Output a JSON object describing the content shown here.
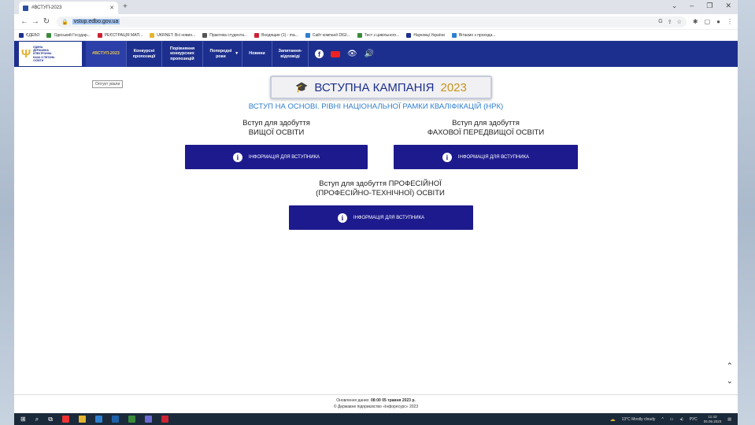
{
  "browser": {
    "tab_title": "#ВСТУП-2023",
    "new_tab": "+",
    "url": "vstup.edbo.gov.ua",
    "bookmarks": [
      {
        "label": "ЄДЕБО",
        "color": "#1d2f8e"
      },
      {
        "label": "Одеський Государ...",
        "color": "#3a8a3a"
      },
      {
        "label": "РЕЄСТРАЦІЯ МАП...",
        "color": "#c23"
      },
      {
        "label": "UKRNET: Всі новин...",
        "color": "#e3b430"
      },
      {
        "label": "Практика студента...",
        "color": "#555"
      },
      {
        "label": "Входящие (1) - ma...",
        "color": "#c23"
      },
      {
        "label": "Сайт компанії DIGI...",
        "color": "#2f7fd0"
      },
      {
        "label": "Тест з цивільного...",
        "color": "#3a8a3a"
      },
      {
        "label": "Науковці України",
        "color": "#1d2f8e"
      },
      {
        "label": "Вітаємо з прохода...",
        "color": "#2f7fd0"
      }
    ]
  },
  "site": {
    "logo_text": [
      "ЄДИНА",
      "ДЕРЖАВНА",
      "ЕЛЕКТРОННА",
      "БАЗА З ПИТАНЬ",
      "ОСВІТИ"
    ],
    "menu": [
      {
        "label": "#ВСТУП-2023",
        "active": true
      },
      {
        "label": "Конкурсні пропозиції",
        "active": false
      },
      {
        "label": "Порівняння конкурсних пропозицій",
        "active": false
      },
      {
        "label": "Попередні роки",
        "active": false
      },
      {
        "label": "Новини",
        "active": false
      },
      {
        "label": "Запитання-відповіді",
        "active": false
      }
    ],
    "tooltip": "Оптует ували"
  },
  "main": {
    "campaign_title": "ВСТУПНА КАМПАНІЯ",
    "campaign_year": "2023",
    "subtitle": "ВСТУП НА ОСНОВІ. РІВНІ НАЦІОНАЛЬНОЇ РАМКИ КВАЛІФІКАЦІЙ (НРК)",
    "sections": [
      {
        "line1": "Вступ для здобуття",
        "line2": "ВИЩОЇ ОСВІТИ",
        "button": "ІНФОРМАЦІЯ ДЛЯ ВСТУПНИКА"
      },
      {
        "line1": "Вступ для здобуття",
        "line2": "ФАХОВОЇ ПЕРЕДВИЩОЇ ОСВІТИ",
        "button": "ІНФОРМАЦІЯ ДЛЯ ВСТУПНИКА"
      },
      {
        "line1": "Вступ для здобуття ПРОФЕСІЙНОЇ",
        "line2": "(ПРОФЕСІЙНО-ТЕХНІЧНОЇ) ОСВІТИ",
        "button": "ІНФОРМАЦІЯ ДЛЯ ВСТУПНИКА"
      }
    ]
  },
  "footer": {
    "updated_label": "Оновлення даних:",
    "updated_value": "08:00 05 травня 2023 р.",
    "copyright": "© Державне підприємство «Інфоресурс» 2023"
  },
  "taskbar": {
    "weather": "13°C  Mostly cloudy",
    "lang": "РУС",
    "time": "11:43",
    "date": "05.05.2023"
  },
  "colors": {
    "header_bg": "#1d2f8e",
    "button_bg": "#1d1a8e",
    "accent_gold": "#c7931a",
    "subtitle_blue": "#2f7fd0"
  }
}
